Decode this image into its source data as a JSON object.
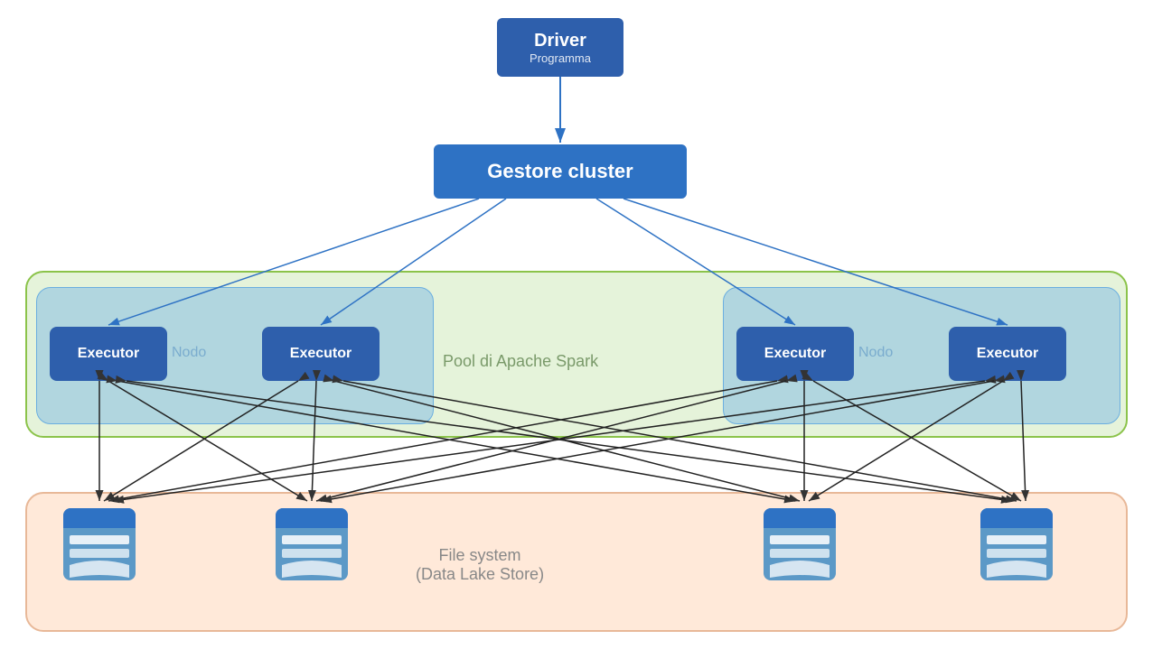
{
  "driver": {
    "title": "Driver",
    "subtitle": "Programma"
  },
  "cluster_manager": {
    "label": "Gestore cluster"
  },
  "spark_pool": {
    "label": "Pool di Apache Spark"
  },
  "nodes": [
    {
      "label": "Nodo"
    },
    {
      "label": "Nodo"
    }
  ],
  "executors": [
    {
      "label": "Executor"
    },
    {
      "label": "Executor"
    },
    {
      "label": "Executor"
    },
    {
      "label": "Executor"
    }
  ],
  "filesystem": {
    "label": "File system\n(Data Lake Store)"
  },
  "colors": {
    "driver_bg": "#2E5FAC",
    "cluster_bg": "#2E72C4",
    "executor_bg": "#2E5FAC",
    "spark_pool_border": "#8BC34A",
    "node_border": "#6aaee0",
    "filesystem_border": "#e8b898"
  }
}
